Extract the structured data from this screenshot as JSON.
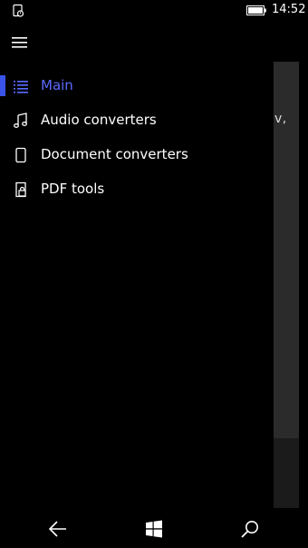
{
  "status_bar": {
    "time": "14:52"
  },
  "background_page": {
    "visible_text": "v,"
  },
  "nav_pane": {
    "items": [
      {
        "label": "Main",
        "icon": "list-icon",
        "selected": true
      },
      {
        "label": "Audio converters",
        "icon": "music-note-icon",
        "selected": false
      },
      {
        "label": "Document converters",
        "icon": "document-icon",
        "selected": false
      },
      {
        "label": "PDF tools",
        "icon": "pdf-lock-icon",
        "selected": false
      }
    ]
  },
  "colors": {
    "accent": "#5b6cff",
    "selection_bar": "#3a53e8",
    "background": "#000000",
    "page_behind": "#2b2b2b"
  },
  "system_nav": {
    "buttons": [
      "back-arrow-icon",
      "windows-start-icon",
      "search-icon"
    ]
  }
}
